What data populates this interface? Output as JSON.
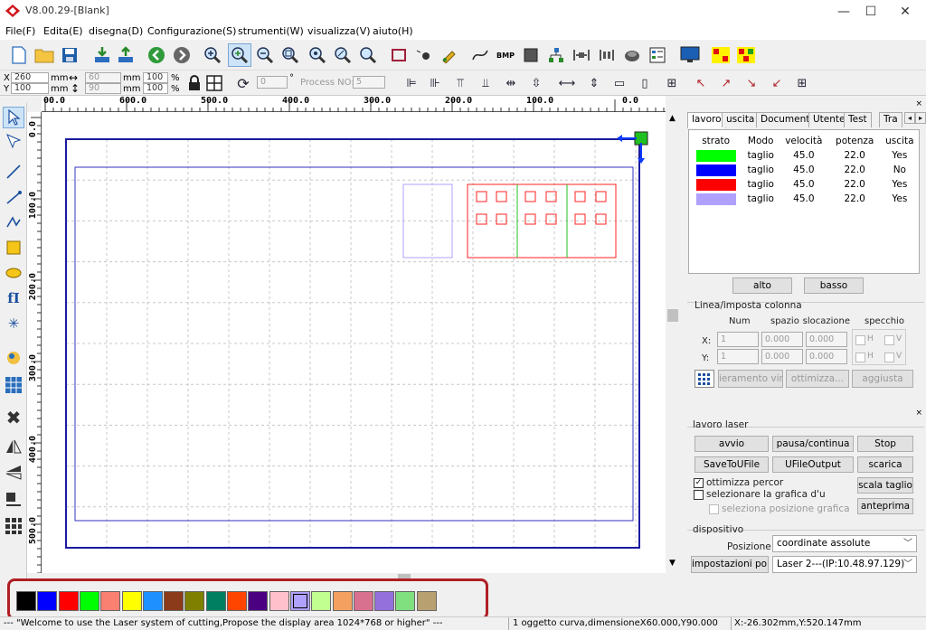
{
  "window": {
    "title": "V8.00.29-[Blank]",
    "minimize": "—",
    "maximize": "☐",
    "close": "✕"
  },
  "menu": [
    "File(F)",
    "Edita(E)",
    "disegna(D)",
    "Configurazione(S)",
    "strumenti(W)",
    "visualizza(V)",
    "aiuto(H)"
  ],
  "toolbar2": {
    "x_label": "X",
    "x_value": "260",
    "y_label": "Y",
    "y_value": "100",
    "unit_mm": "mm",
    "w_value": "60",
    "h_value": "90",
    "pct_w": "100",
    "pct_h": "100",
    "pct_sign": "%",
    "angle_value": "0",
    "degree_sign": "°",
    "process_no_label": "Process NO:",
    "process_no_value": "5"
  },
  "ruler": {
    "top": [
      "00.0",
      "600.0",
      "500.0",
      "400.0",
      "300.0",
      "200.0",
      "100.0",
      "0.0"
    ],
    "left": [
      "0.0",
      "100.0",
      "200.0",
      "300.0",
      "400.0",
      "500.0"
    ]
  },
  "layer_panel": {
    "tabs": [
      "lavoro",
      "uscita",
      "Documenti",
      "Utente",
      "Test",
      "Tra"
    ],
    "columns": [
      "strato",
      "Modo",
      "velocità",
      "potenza",
      "uscita"
    ],
    "rows": [
      {
        "color": "#00ff00",
        "mode": "taglio",
        "speed": "45.0",
        "power": "22.0",
        "output": "Yes"
      },
      {
        "color": "#0000ff",
        "mode": "taglio",
        "speed": "45.0",
        "power": "22.0",
        "output": "No"
      },
      {
        "color": "#ff0000",
        "mode": "taglio",
        "speed": "45.0",
        "power": "22.0",
        "output": "Yes"
      },
      {
        "color": "#b0a0ff",
        "mode": "taglio",
        "speed": "45.0",
        "power": "22.0",
        "output": "Yes"
      }
    ],
    "up_button": "alto",
    "down_button": "basso",
    "array_group": "Linea/imposta colonna",
    "array_headers": {
      "num": "Num",
      "space": "spazio",
      "offset": "Dislocazione",
      "mirror": "specchio"
    },
    "array_x": {
      "label": "X:",
      "num": "1",
      "space": "0.000",
      "offset": "0.000"
    },
    "array_y": {
      "label": "Y:",
      "num": "1",
      "space": "0.000",
      "offset": "0.000"
    },
    "mirror_h": "H",
    "mirror_v": "V",
    "virtual_array_button": "ieramento virtu",
    "optimize_button": "ottimizza...",
    "update_button": "aggiusta"
  },
  "laser_panel": {
    "group": "lavoro laser",
    "start": "avvio",
    "pause": "pausa/continua",
    "stop": "Stop",
    "save_to_ufile": "SaveToUFile",
    "ufile_output": "UFileOutput",
    "download": "scarica",
    "optimize_path": "ottimizza percor",
    "select_graphic": "selezionare la grafica d'u",
    "select_position": "seleziona posizione grafica",
    "scale_cut": "scala taglio",
    "preview": "anteprima",
    "device_group": "dispositivo",
    "position_label": "Posizione:",
    "position_value": "coordinate assolute",
    "port_settings": "impostazioni porta",
    "laser_value": "Laser 2---(IP:10.48.97.129)"
  },
  "palette": [
    "#000000",
    "#0000ff",
    "#ff0000",
    "#00ff00",
    "#fa8072",
    "#ffff00",
    "#1e90ff",
    "#8b3a1a",
    "#808000",
    "#008060",
    "#ff4500",
    "#4b0082",
    "#ffc0cb",
    "#b0a0ff",
    "#c0ff90",
    "#f4a060",
    "#d87090",
    "#9370db",
    "#80e080",
    "#b8a070"
  ],
  "status": {
    "message": "--- \"Welcome to use the Laser system of cutting,Propose the display area 1024*768 or higher\" ---",
    "object": "1 oggetto curva,dimensioneX60.000,Y90.000",
    "coords": "X:-26.302mm,Y:520.147mm"
  }
}
